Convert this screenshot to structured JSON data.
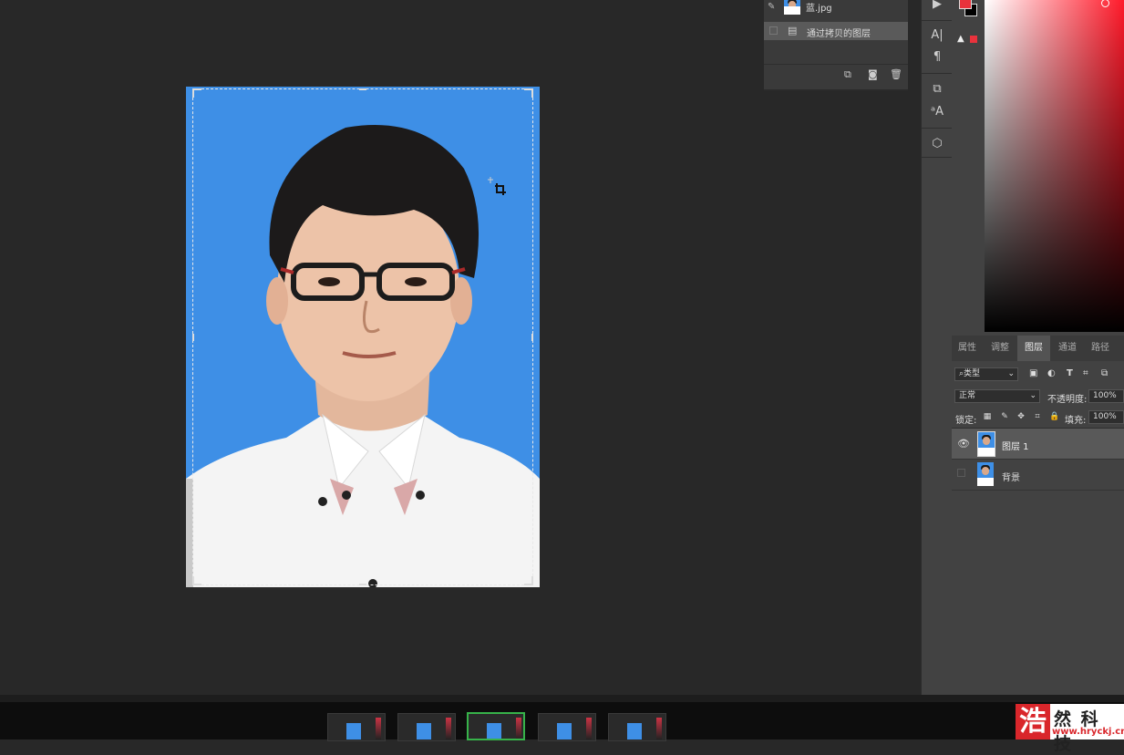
{
  "history": {
    "items": [
      {
        "label": "蓝.jpg",
        "type": "snapshot"
      },
      {
        "label": "通过拷贝的图层",
        "type": "step"
      }
    ],
    "footer_icons": [
      "new-snapshot-icon",
      "camera-icon",
      "trash-icon"
    ]
  },
  "toolstrip": {
    "icons": [
      "play-icon",
      "character-icon",
      "paragraph-icon",
      "clone-source-icon",
      "character-style-icon",
      "3d-icon"
    ]
  },
  "color": {
    "foreground": "#e8323c",
    "background": "#000000",
    "gamut_warning_color": "#e8323c"
  },
  "layers_panel": {
    "tabs": [
      "属性",
      "调整",
      "图层",
      "通道",
      "路径"
    ],
    "active_tab": "图层",
    "filter_kind": "类型",
    "blend_mode": "正常",
    "opacity_label": "不透明度:",
    "opacity_value": "100%",
    "lock_label": "锁定:",
    "fill_label": "填充:",
    "fill_value": "100%",
    "layers": [
      {
        "name": "图层 1",
        "visible": true,
        "selected": true
      },
      {
        "name": "背景",
        "visible": false,
        "selected": false
      }
    ]
  },
  "logo": {
    "mark": "浩",
    "name": "然 科 技",
    "url": "www.hryckj.cn"
  }
}
